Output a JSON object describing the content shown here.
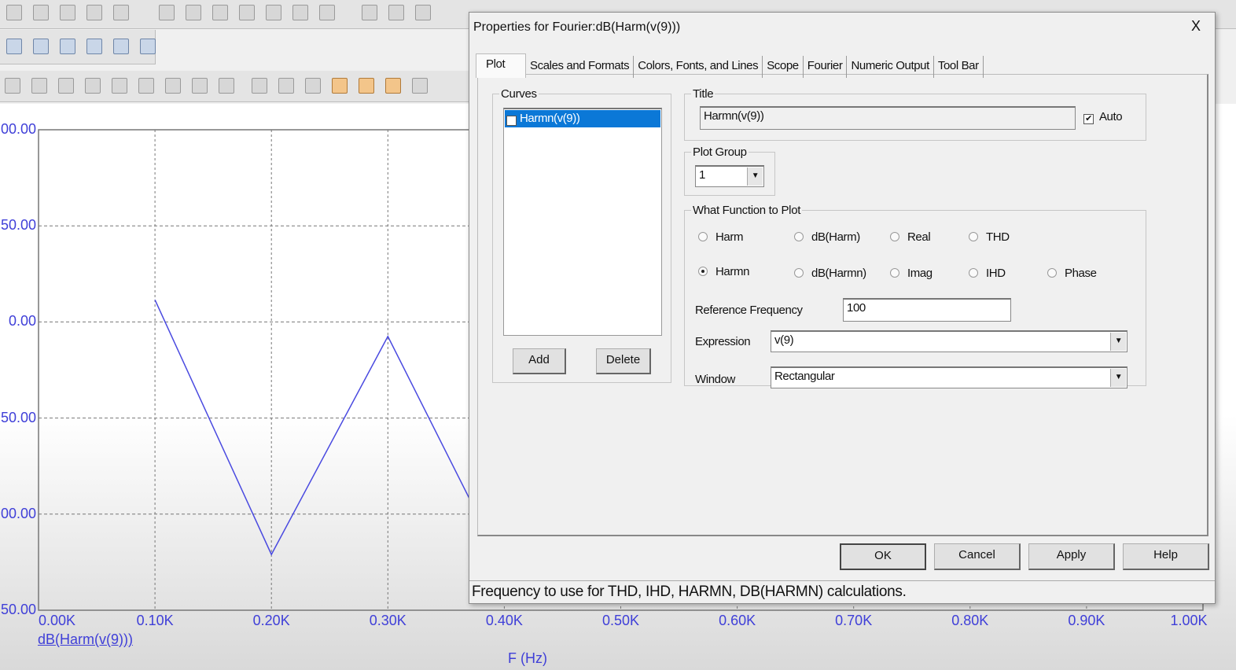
{
  "toolbar": {
    "icons": [
      "open-icon",
      "save-icon",
      "refresh-icon",
      "print-preview-icon",
      "print-icon",
      "undo-icon",
      "redo-icon",
      "cut-icon",
      "copy-icon",
      "paste-icon",
      "delete-icon",
      "select-icon",
      "ground-icon",
      "resistor-icon",
      "capacitor-icon"
    ]
  },
  "chart_data": {
    "type": "line",
    "x": [
      100,
      200,
      300,
      400
    ],
    "series": [
      {
        "name": "dB(Harm(v(9)))",
        "values": [
          11.5,
          -121,
          -7.5,
          -128
        ],
        "color": "#4a4ae0"
      }
    ],
    "xlim": [
      0,
      1000
    ],
    "ylim": [
      -150,
      100
    ],
    "x_ticks": [
      "0.00K",
      "0.10K",
      "0.20K",
      "0.30K",
      "0.40K",
      "0.50K",
      "0.60K",
      "0.70K",
      "0.80K",
      "0.90K",
      "1.00K"
    ],
    "y_tick_labels_visible": [
      "00.00",
      "50.00",
      "0.00",
      "50.00",
      "00.00",
      "50.00"
    ],
    "xlabel": "F (Hz)",
    "legend": "dB(Harm(v(9)))",
    "grid": true
  },
  "dialog": {
    "title": "Properties for Fourier:dB(Harm(v(9)))",
    "close": "X",
    "tabs": [
      "Plot",
      "Scales and Formats",
      "Colors, Fonts, and Lines",
      "Scope",
      "Fourier",
      "Numeric Output",
      "Tool Bar"
    ],
    "curves": {
      "label": "Curves",
      "items": [
        {
          "label": "Harmn(v(9))",
          "checked": true,
          "selected": true
        }
      ],
      "add": "Add",
      "delete": "Delete"
    },
    "title_group": {
      "label": "Title",
      "value": "Harmn(v(9))",
      "auto_label": "Auto",
      "auto_checked": true
    },
    "plot_group": {
      "label": "Plot Group",
      "value": "1"
    },
    "function": {
      "label": "What Function to Plot",
      "options": [
        "Harm",
        "dB(Harm)",
        "Real",
        "THD",
        "Harmn",
        "dB(Harmn)",
        "Imag",
        "IHD",
        "Phase"
      ],
      "selected": "Harmn"
    },
    "ref_freq": {
      "label": "Reference Frequency",
      "value": "100"
    },
    "expression": {
      "label": "Expression",
      "value": "v(9)"
    },
    "window": {
      "label": "Window",
      "value": "Rectangular"
    },
    "buttons": {
      "ok": "OK",
      "cancel": "Cancel",
      "apply": "Apply",
      "help": "Help"
    },
    "status": "Frequency to use for THD, IHD, HARMN, DB(HARMN) calculations."
  }
}
